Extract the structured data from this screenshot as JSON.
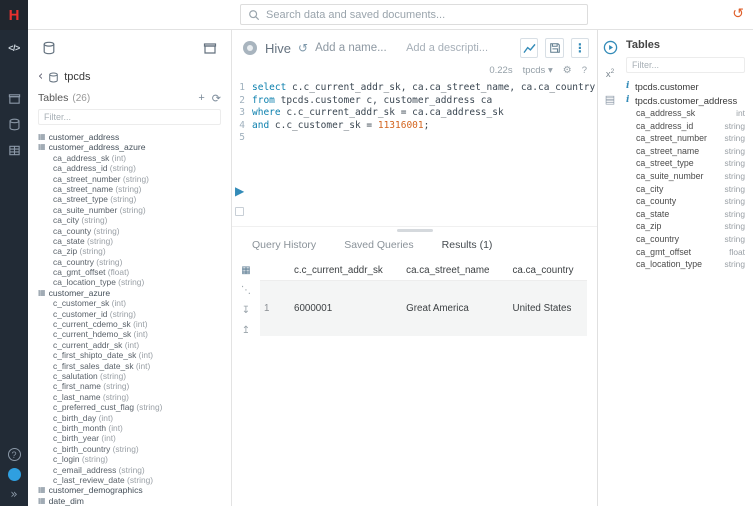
{
  "topbar": {
    "logo_letter": "H",
    "search_placeholder": "Search data and saved documents..."
  },
  "left_panel": {
    "db_name": "tpcds",
    "tables_label": "Tables",
    "tables_count": "(26)",
    "filter_placeholder": "Filter...",
    "tree": [
      {
        "k": "table",
        "n": "customer_address"
      },
      {
        "k": "table",
        "n": "customer_address_azure"
      },
      {
        "k": "col",
        "n": "ca_address_sk",
        "t": "int"
      },
      {
        "k": "col",
        "n": "ca_address_id",
        "t": "string"
      },
      {
        "k": "col",
        "n": "ca_street_number",
        "t": "string"
      },
      {
        "k": "col",
        "n": "ca_street_name",
        "t": "string"
      },
      {
        "k": "col",
        "n": "ca_street_type",
        "t": "string"
      },
      {
        "k": "col",
        "n": "ca_suite_number",
        "t": "string"
      },
      {
        "k": "col",
        "n": "ca_city",
        "t": "string"
      },
      {
        "k": "col",
        "n": "ca_county",
        "t": "string"
      },
      {
        "k": "col",
        "n": "ca_state",
        "t": "string"
      },
      {
        "k": "col",
        "n": "ca_zip",
        "t": "string"
      },
      {
        "k": "col",
        "n": "ca_country",
        "t": "string"
      },
      {
        "k": "col",
        "n": "ca_gmt_offset",
        "t": "float"
      },
      {
        "k": "col",
        "n": "ca_location_type",
        "t": "string"
      },
      {
        "k": "table",
        "n": "customer_azure"
      },
      {
        "k": "col",
        "n": "c_customer_sk",
        "t": "int"
      },
      {
        "k": "col",
        "n": "c_customer_id",
        "t": "string"
      },
      {
        "k": "col",
        "n": "c_current_cdemo_sk",
        "t": "int"
      },
      {
        "k": "col",
        "n": "c_current_hdemo_sk",
        "t": "int"
      },
      {
        "k": "col",
        "n": "c_current_addr_sk",
        "t": "int"
      },
      {
        "k": "col",
        "n": "c_first_shipto_date_sk",
        "t": "int"
      },
      {
        "k": "col",
        "n": "c_first_sales_date_sk",
        "t": "int"
      },
      {
        "k": "col",
        "n": "c_salutation",
        "t": "string"
      },
      {
        "k": "col",
        "n": "c_first_name",
        "t": "string"
      },
      {
        "k": "col",
        "n": "c_last_name",
        "t": "string"
      },
      {
        "k": "col",
        "n": "c_preferred_cust_flag",
        "t": "string"
      },
      {
        "k": "col",
        "n": "c_birth_day",
        "t": "int"
      },
      {
        "k": "col",
        "n": "c_birth_month",
        "t": "int"
      },
      {
        "k": "col",
        "n": "c_birth_year",
        "t": "int"
      },
      {
        "k": "col",
        "n": "c_birth_country",
        "t": "string"
      },
      {
        "k": "col",
        "n": "c_login",
        "t": "string"
      },
      {
        "k": "col",
        "n": "c_email_address",
        "t": "string"
      },
      {
        "k": "col",
        "n": "c_last_review_date",
        "t": "string"
      },
      {
        "k": "table",
        "n": "customer_demographics"
      },
      {
        "k": "table",
        "n": "date_dim"
      }
    ]
  },
  "editor": {
    "engine": "Hive",
    "name_placeholder": "Add a name...",
    "desc_placeholder": "Add a descripti...",
    "exec_time": "0.22s",
    "database": "tpcds",
    "code": [
      {
        "num": "1",
        "tokens": [
          {
            "c": "kw",
            "t": "select"
          },
          {
            "c": "pl",
            "t": " c.c_current_addr_sk, ca.ca_street_name, ca.ca_country"
          }
        ]
      },
      {
        "num": "2",
        "tokens": [
          {
            "c": "kw",
            "t": "from"
          },
          {
            "c": "pl",
            "t": " tpcds.customer c, customer_address ca"
          }
        ]
      },
      {
        "num": "3",
        "tokens": [
          {
            "c": "kw",
            "t": "where"
          },
          {
            "c": "pl",
            "t": " c.c_current_addr_sk = ca.ca_address_sk"
          }
        ]
      },
      {
        "num": "4",
        "tokens": [
          {
            "c": "kw",
            "t": "and"
          },
          {
            "c": "pl",
            "t": " c.c_customer_sk = "
          },
          {
            "c": "num",
            "t": "11316001"
          },
          {
            "c": "pl",
            "t": ";"
          }
        ]
      },
      {
        "num": "5",
        "tokens": []
      }
    ]
  },
  "results": {
    "tabs": [
      {
        "label": "Query History",
        "active": false
      },
      {
        "label": "Saved Queries",
        "active": false
      },
      {
        "label": "Results (1)",
        "active": true
      }
    ],
    "columns": [
      "c.c_current_addr_sk",
      "ca.ca_street_name",
      "ca.ca_country"
    ],
    "rows": [
      {
        "idx": "1",
        "cells": [
          "6000001",
          "Great America",
          "United States"
        ]
      }
    ]
  },
  "right_panel": {
    "title": "Tables",
    "filter_placeholder": "Filter...",
    "items": [
      {
        "k": "db",
        "n": "tpcds.customer"
      },
      {
        "k": "db",
        "n": "tpcds.customer_address"
      },
      {
        "k": "col",
        "n": "ca_address_sk",
        "t": "int"
      },
      {
        "k": "col",
        "n": "ca_address_id",
        "t": "string"
      },
      {
        "k": "col",
        "n": "ca_street_number",
        "t": "string"
      },
      {
        "k": "col",
        "n": "ca_street_name",
        "t": "string"
      },
      {
        "k": "col",
        "n": "ca_street_type",
        "t": "string"
      },
      {
        "k": "col",
        "n": "ca_suite_number",
        "t": "string"
      },
      {
        "k": "col",
        "n": "ca_city",
        "t": "string"
      },
      {
        "k": "col",
        "n": "ca_county",
        "t": "string"
      },
      {
        "k": "col",
        "n": "ca_state",
        "t": "string"
      },
      {
        "k": "col",
        "n": "ca_zip",
        "t": "string"
      },
      {
        "k": "col",
        "n": "ca_country",
        "t": "string"
      },
      {
        "k": "col",
        "n": "ca_gmt_offset",
        "t": "float"
      },
      {
        "k": "col",
        "n": "ca_location_type",
        "t": "string"
      }
    ]
  },
  "colors": {
    "accent": "#338bb8",
    "logo_red": "#e8312e",
    "rail_bg": "#222b36",
    "keyword": "#0b7fad",
    "number": "#d3641e",
    "history_icon": "#df5f2a"
  }
}
